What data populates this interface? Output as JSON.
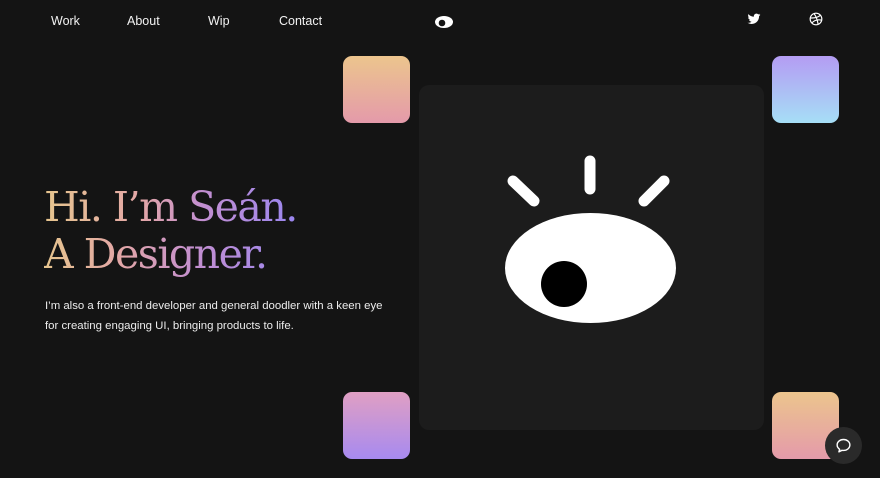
{
  "nav": {
    "items": [
      {
        "label": "Work"
      },
      {
        "label": "About"
      },
      {
        "label": "Wip"
      },
      {
        "label": "Contact"
      }
    ]
  },
  "header": {
    "logo_icon": "eye-logo-icon",
    "social": [
      {
        "icon": "twitter-icon"
      },
      {
        "icon": "dribbble-icon"
      }
    ]
  },
  "hero": {
    "title_line1": "Hi. I’m Seán.",
    "title_line2": "A Designer.",
    "description": "I’m also a front-end developer and general doodler with a keen eye for creating engaging UI, bringing products to life."
  },
  "chat": {
    "icon": "chat-bubble-icon"
  },
  "colors": {
    "background": "#141414",
    "panel": "#1c1c1c",
    "gradient_gold": "#e6c58e",
    "gradient_pink": "#e3a7a7",
    "gradient_violet": "#9a86f0",
    "gradient_sky": "#a6def6"
  }
}
